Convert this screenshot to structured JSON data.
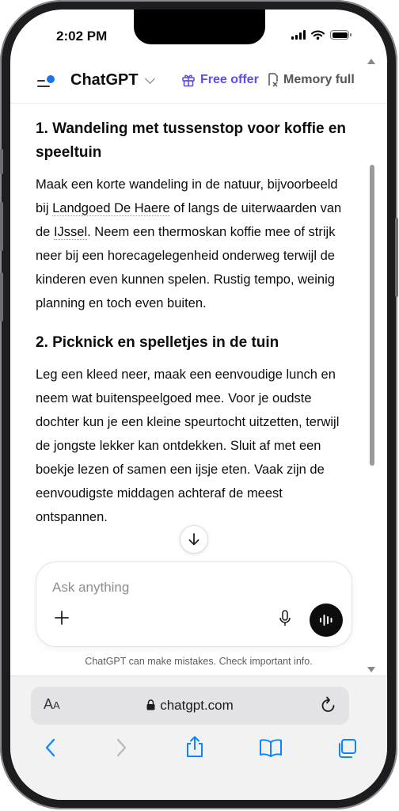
{
  "status": {
    "time": "2:02 PM"
  },
  "header": {
    "title": "ChatGPT",
    "free_offer": "Free offer",
    "memory": "Memory full"
  },
  "content": {
    "section1": {
      "heading": "1. Wandeling met tussenstop voor koffie en speeltuin",
      "text_before": "Maak een korte wandeling in de natuur, bijvoorbeeld bij ",
      "link1": "Landgoed De Haere",
      "text_mid": " of langs de uiterwaarden van de ",
      "link2": "IJssel",
      "text_after": ". Neem een thermoskan koffie mee of strijk neer bij een horecagelegenheid onderweg terwijl de kinderen even kunnen spelen. Rustig tempo, weinig planning en toch even buiten."
    },
    "section2": {
      "heading": "2. Picknick en spelletjes in de tuin",
      "text": "Leg een kleed neer, maak een eenvoudige lunch en neem wat buitenspeelgoed mee. Voor je oudste dochter kun je een kleine speurtocht uitzetten, terwijl de jongste lekker kan ontdekken. Sluit af met een boekje lezen of samen een ijsje eten. Vaak zijn de eenvoudigste middagen achteraf de meest ontspannen."
    }
  },
  "composer": {
    "placeholder": "Ask anything"
  },
  "disclaimer": "ChatGPT can make mistakes. Check important info.",
  "browser": {
    "aa_big": "A",
    "aa_small": "A",
    "url": "chatgpt.com"
  },
  "icons": [
    "menu-icon",
    "chevron-down-icon",
    "gift-icon",
    "memory-icon",
    "arrow-down-icon",
    "plus-icon",
    "mic-icon",
    "voice-icon",
    "lock-icon",
    "reload-icon",
    "back-icon",
    "forward-icon",
    "share-icon",
    "bookmarks-icon",
    "tabs-icon"
  ],
  "colors": {
    "accent": "#5b4de8",
    "notification_dot": "#1a73e8",
    "safari_blue": "#0a84ff"
  }
}
